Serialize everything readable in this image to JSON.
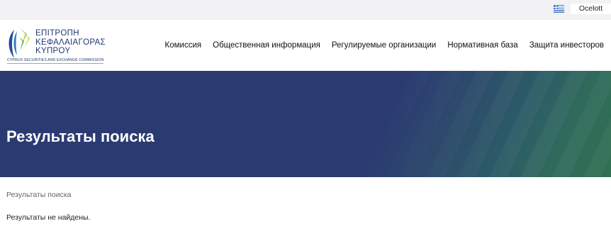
{
  "topbar": {
    "language_flag_icon": "greek-flag-icon",
    "user_label": "Ocelott"
  },
  "header": {
    "logo": {
      "line1": "ΕΠΙΤΡΟΠΗ",
      "line2": "ΚΕΦΑΛΑΙΑΓΟΡΑΣ",
      "line3": "ΚΥΠΡΟΥ",
      "subtitle": "CYPRUS SECURITIES AND EXCHANGE COMMISSION"
    },
    "nav": [
      {
        "label": "Комиссия"
      },
      {
        "label": "Общественная информация"
      },
      {
        "label": "Регулируемые организации"
      },
      {
        "label": "Нормативная база"
      },
      {
        "label": "Защита инвесторов"
      }
    ]
  },
  "hero": {
    "title": "Результаты поиска"
  },
  "breadcrumb": "Результаты поиска",
  "message": "Результаты не найдены.",
  "colors": {
    "hero_start": "#2b3b72",
    "hero_end": "#2f7151",
    "brand_blue": "#1f3a73",
    "brand_green": "#8bc34a"
  }
}
